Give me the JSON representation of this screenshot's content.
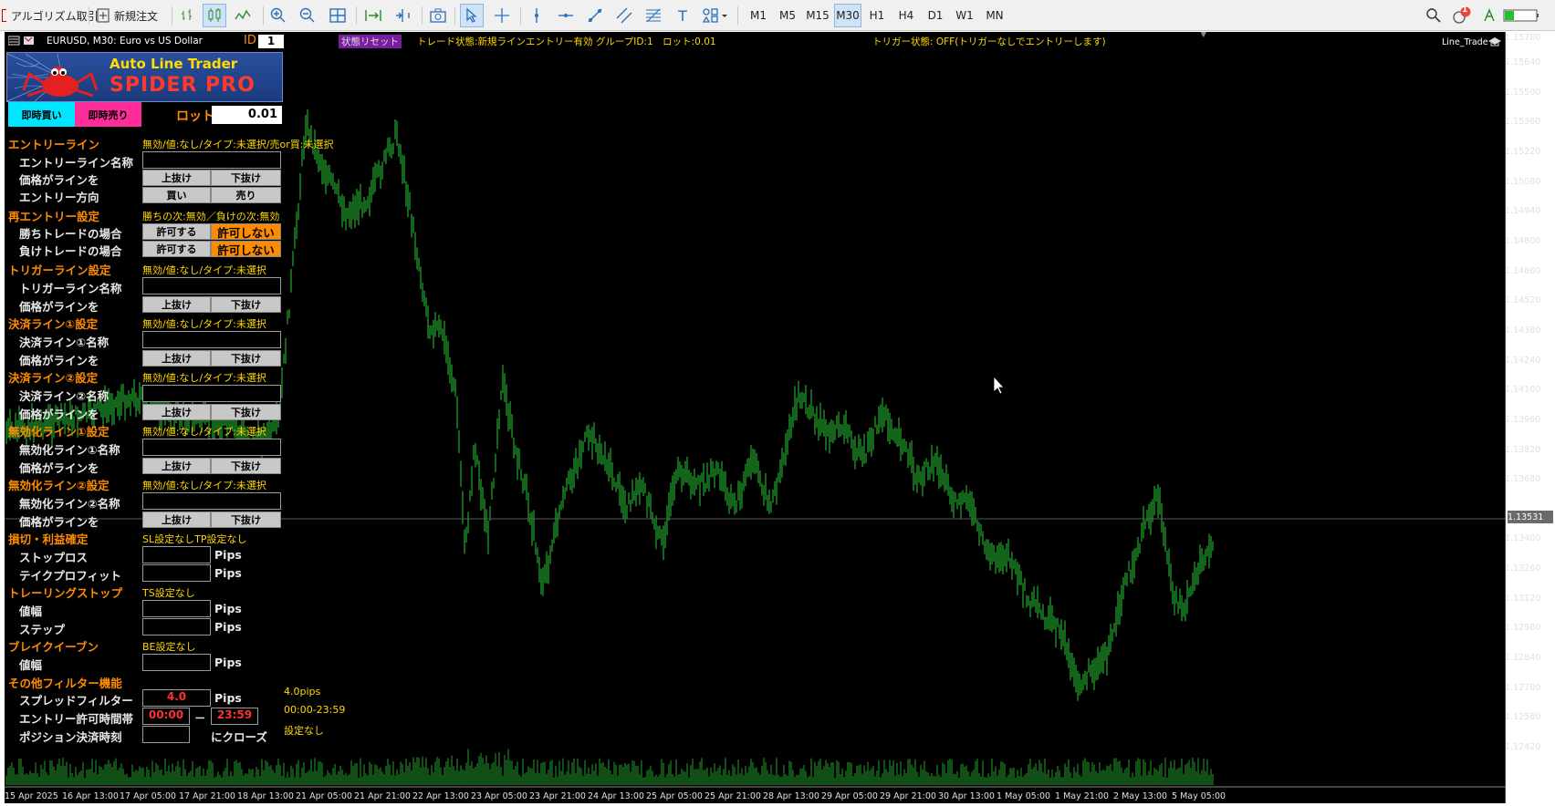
{
  "toolbar": {
    "algo_label": "アルゴリズム取引",
    "new_order_label": "新規注文",
    "timeframes": [
      "M1",
      "M5",
      "M15",
      "M30",
      "H1",
      "H4",
      "D1",
      "W1",
      "MN"
    ],
    "selected_timeframe": "M30",
    "notification_count": "1"
  },
  "chart": {
    "symbol": "EURUSD, M30:  Euro vs US Dollar",
    "id_label": "ID",
    "id_value": "1",
    "reset_badge": "状態リセット",
    "trade_status": "トレード状態:新規ラインエントリー有効 グループID:1　ロット:0.01",
    "trigger_status": "トリガー状態: OFF(トリガーなしでエントリーします)",
    "ea_name": "Line_Trade",
    "current_price": "1.13531",
    "price_labels": [
      "1.15640",
      "1.15500",
      "1.15360",
      "1.15220",
      "1.15080",
      "1.14940",
      "1.14800",
      "1.14660",
      "1.14520",
      "1.14380",
      "1.14240",
      "1.14100",
      "1.13960",
      "1.13820",
      "1.13680",
      "1.13400",
      "1.13260",
      "1.13120",
      "1.12980",
      "1.12840",
      "1.12700",
      "1.12560",
      "1.12420"
    ],
    "top_price": "1.15780",
    "time_labels": [
      "15 Apr 2025",
      "16 Apr 13:00",
      "17 Apr 05:00",
      "17 Apr 21:00",
      "18 Apr 13:00",
      "21 Apr 05:00",
      "21 Apr 21:00",
      "22 Apr 13:00",
      "23 Apr 05:00",
      "23 Apr 21:00",
      "24 Apr 13:00",
      "25 Apr 05:00",
      "25 Apr 21:00",
      "28 Apr 13:00",
      "29 Apr 05:00",
      "29 Apr 21:00",
      "30 Apr 13:00",
      "1 May 05:00",
      "1 May 21:00",
      "2 May 13:00",
      "5 May 05:00"
    ]
  },
  "panel": {
    "logo_line1": "Auto Line Trader",
    "logo_line2": "SPIDER PRO",
    "buy_now": "即時買い",
    "sell_now": "即時売り",
    "lot_label": "ロット",
    "lot_value": "0.01",
    "entry_header": "エントリーライン",
    "entry_status": "無効/値:なし/タイプ:未選択/売or買:未選択",
    "entry_name_label": "エントリーライン名称",
    "price_line_label": "価格がラインを",
    "break_up": "上抜け",
    "break_down": "下抜け",
    "entry_dir_label": "エントリー方向",
    "buy": "買い",
    "sell": "売り",
    "reentry_header": "再エントリー設定",
    "reentry_status": "勝ちの次:無効／負けの次:無効",
    "win_label": "勝ちトレードの場合",
    "lose_label": "負けトレードの場合",
    "allow": "許可する",
    "deny": "許可しない",
    "trigger_header": "トリガーライン設定",
    "line_status": "無効/値:なし/タイプ:未選択",
    "trigger_name_label": "トリガーライン名称",
    "settle1_header": "決済ライン①設定",
    "settle1_name_label": "決済ライン①名称",
    "settle2_header": "決済ライン②設定",
    "settle2_name_label": "決済ライン②名称",
    "inval1_header": "無効化ライン①設定",
    "inval1_name_label": "無効化ライン①名称",
    "inval2_header": "無効化ライン②設定",
    "inval2_name_label": "無効化ライン②名称",
    "sltp_header": "損切・利益確定",
    "sltp_status": "SL設定なしTP設定なし",
    "stoploss_label": "ストップロス",
    "takeprofit_label": "テイクプロフィット",
    "pips": "Pips",
    "trailing_header": "トレーリングストップ",
    "trailing_status": "TS設定なし",
    "width_label": "値幅",
    "step_label": "ステップ",
    "breakeven_header": "ブレイクイーブン",
    "breakeven_status": "BE設定なし",
    "filter_header": "その他フィルター機能",
    "spread_label": "スプレッドフィルター",
    "spread_value": "4.0",
    "spread_status": "4.0pips",
    "time_label": "エントリー許可時間帯",
    "time_start": "00:00",
    "time_dash": "－",
    "time_end": "23:59",
    "time_status": "00:00-23:59",
    "close_label": "ポジション決済時刻",
    "close_suffix": "にクローズ",
    "close_status": "設定なし"
  },
  "colors": {
    "candle": "#1f9c2a",
    "accent": "#ff8c00",
    "status": "#ffd700",
    "buy": "#00e5ff",
    "sell": "#ff2d9a"
  }
}
